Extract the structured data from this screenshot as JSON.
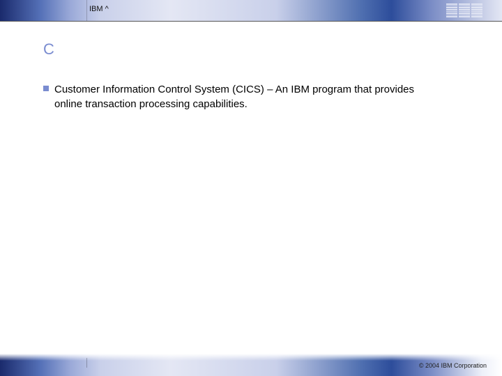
{
  "header": {
    "product_label": "IBM ^",
    "brand": "IBM"
  },
  "title": "C",
  "bullets": [
    {
      "text": "Customer Information Control System (CICS) – An IBM program that provides online transaction processing capabilities."
    }
  ],
  "footer": {
    "copyright": "© 2004 IBM Corporation"
  }
}
